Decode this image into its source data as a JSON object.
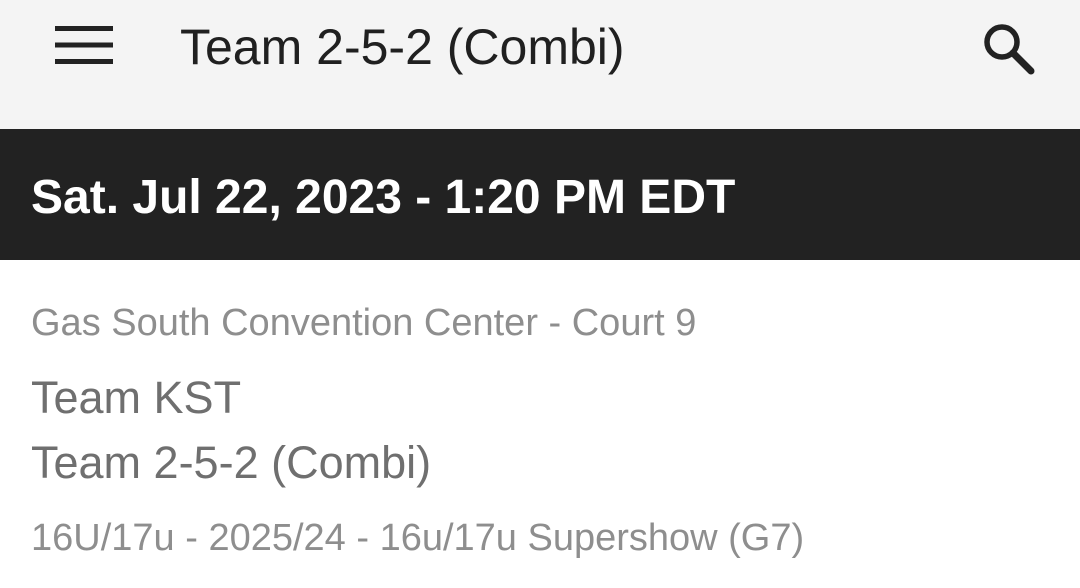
{
  "header": {
    "title": "Team 2-5-2 (Combi)",
    "menu_icon": "menu-icon",
    "search_icon": "search-icon"
  },
  "date_header": {
    "text": "Sat. Jul 22, 2023 - 1:20 PM EDT"
  },
  "game": {
    "venue": "Gas South Convention Center - Court 9",
    "team_1": "Team KST",
    "team_2": "Team 2-5-2 (Combi)",
    "division": "16U/17u - 2025/24 - 16u/17u Supershow (G7)"
  },
  "colors": {
    "app_bar_bg": "#f4f4f4",
    "date_bar_bg": "#222222",
    "title_text": "#202020",
    "secondary_text": "#8e8e8e"
  }
}
